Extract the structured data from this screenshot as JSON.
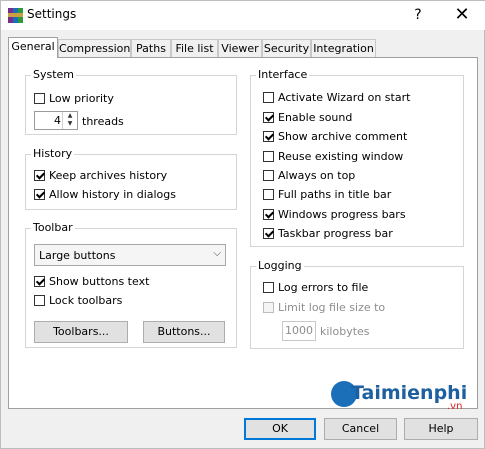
{
  "window": {
    "title": "Settings",
    "help_label": "?",
    "close_label": "✕"
  },
  "tabs": [
    {
      "label": "General",
      "active": true
    },
    {
      "label": "Compression"
    },
    {
      "label": "Paths"
    },
    {
      "label": "File list"
    },
    {
      "label": "Viewer"
    },
    {
      "label": "Security"
    },
    {
      "label": "Integration"
    }
  ],
  "system": {
    "title": "System",
    "low_priority": {
      "label": "Low priority",
      "checked": false
    },
    "threads": {
      "value": "4",
      "label": "threads"
    }
  },
  "history": {
    "title": "History",
    "keep_archives": {
      "label": "Keep archives history",
      "checked": true
    },
    "allow_dialogs": {
      "label": "Allow history in dialogs",
      "checked": true
    }
  },
  "toolbar": {
    "title": "Toolbar",
    "select_value": "Large buttons",
    "show_text": {
      "label": "Show buttons text",
      "checked": true
    },
    "lock": {
      "label": "Lock toolbars",
      "checked": false
    },
    "toolbars_button": "Toolbars...",
    "buttons_button": "Buttons..."
  },
  "interface": {
    "title": "Interface",
    "items": [
      {
        "label": "Activate Wizard on start",
        "checked": false
      },
      {
        "label": "Enable sound",
        "checked": true
      },
      {
        "label": "Show archive comment",
        "checked": true
      },
      {
        "label": "Reuse existing window",
        "checked": false
      },
      {
        "label": "Always on top",
        "checked": false
      },
      {
        "label": "Full paths in title bar",
        "checked": false
      },
      {
        "label": "Windows progress bars",
        "checked": true
      },
      {
        "label": "Taskbar progress bar",
        "checked": true
      }
    ]
  },
  "logging": {
    "title": "Logging",
    "log_errors": {
      "label": "Log errors to file",
      "checked": false
    },
    "limit_size": {
      "label": "Limit log file size to",
      "checked": false,
      "disabled": true
    },
    "size_value": "1000",
    "size_unit": "kilobytes"
  },
  "footer": {
    "ok": "OK",
    "cancel": "Cancel",
    "help": "Help"
  },
  "watermark": {
    "text": "Taimienphi",
    "suffix": ".vn"
  },
  "colors": {
    "accent": "#0078d7"
  }
}
